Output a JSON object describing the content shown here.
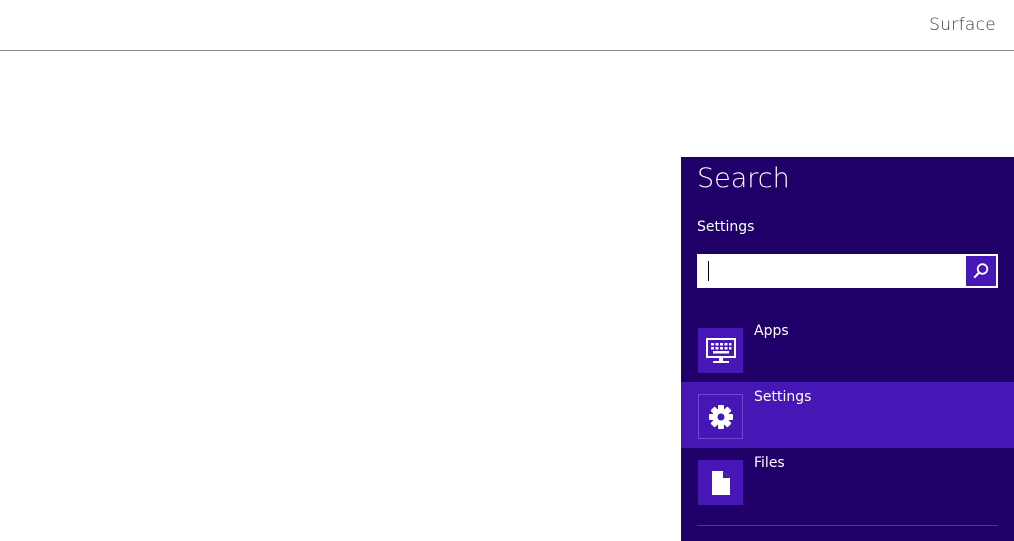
{
  "header": {
    "device_name": "Surface"
  },
  "search_charm": {
    "title": "Search",
    "scope_label": "Settings",
    "search_value": "",
    "scopes": [
      {
        "label": "Apps",
        "icon": "apps-icon",
        "selected": false
      },
      {
        "label": "Settings",
        "icon": "gear-icon",
        "selected": true
      },
      {
        "label": "Files",
        "icon": "file-icon",
        "selected": false
      }
    ]
  },
  "colors": {
    "charm_background": "#1f0068",
    "accent": "#4617b4"
  }
}
